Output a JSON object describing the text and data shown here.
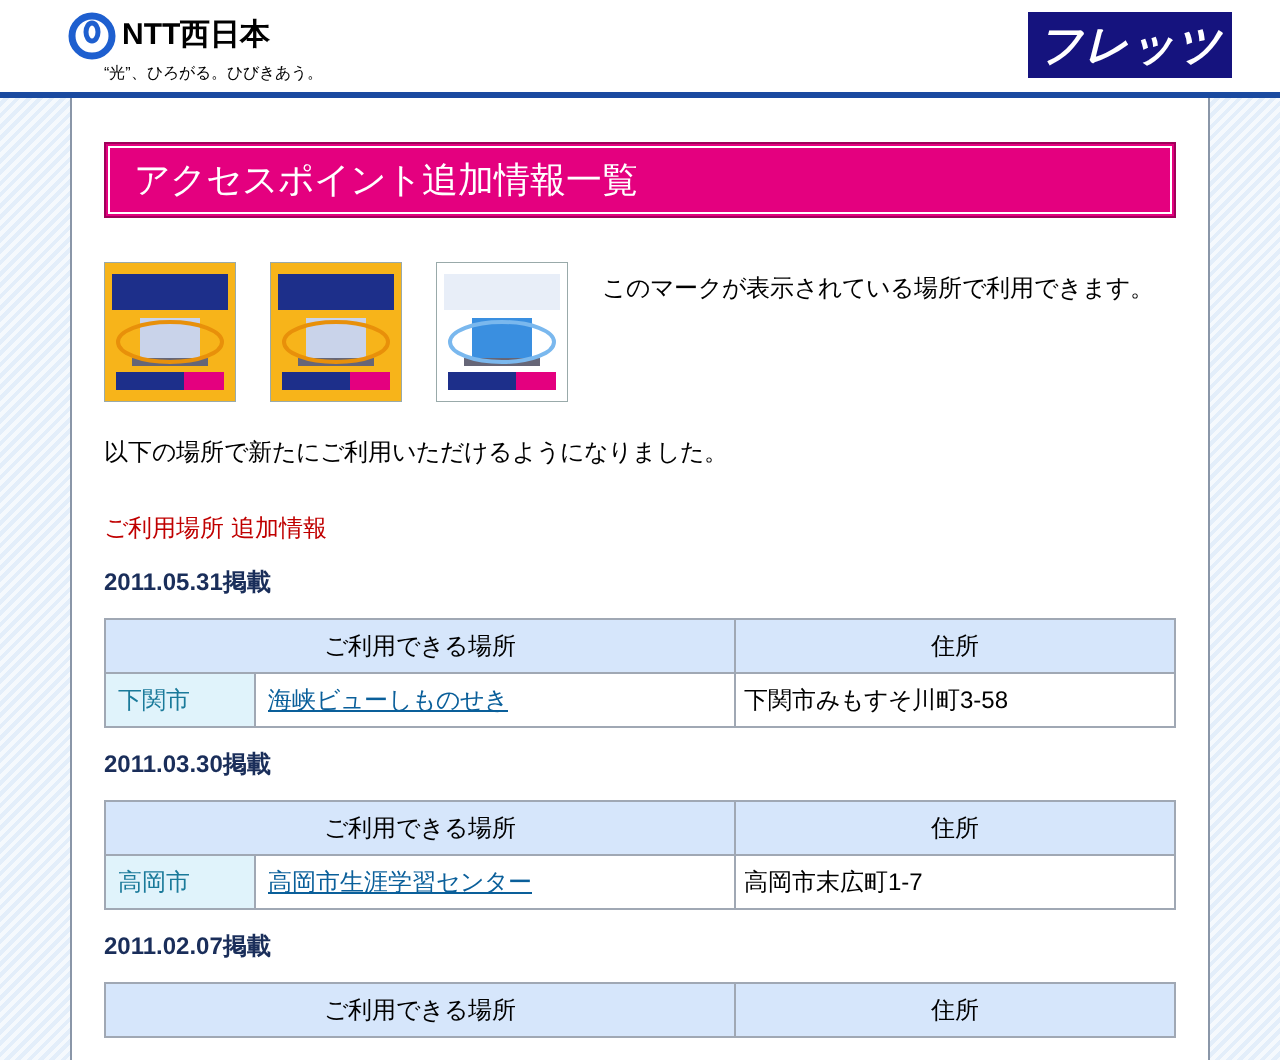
{
  "header": {
    "company": "NTT西日本",
    "tagline": "“光”、ひろがる。ひびきあう。",
    "brand": "フレッツ"
  },
  "page_title": "アクセスポイント追加情報一覧",
  "marks": {
    "caption": "このマークが表示されている場所で利用できます。"
  },
  "intro": "以下の場所で新たにご利用いただけるようになりました。",
  "section_title": "ご利用場所 追加情報",
  "groups": [
    {
      "date": "2011.05.31掲載",
      "columns": [
        "ご利用できる場所",
        "住所"
      ],
      "rows": [
        {
          "city": "下関市",
          "place": "海峡ビューしものせき",
          "address": "下関市みもすそ川町3-58"
        }
      ]
    },
    {
      "date": "2011.03.30掲載",
      "columns": [
        "ご利用できる場所",
        "住所"
      ],
      "rows": [
        {
          "city": "高岡市",
          "place": "高岡市生涯学習センター",
          "address": "高岡市末広町1-7"
        }
      ]
    },
    {
      "date": "2011.02.07掲載",
      "columns": [
        "ご利用できる場所",
        "住所"
      ]
    }
  ]
}
